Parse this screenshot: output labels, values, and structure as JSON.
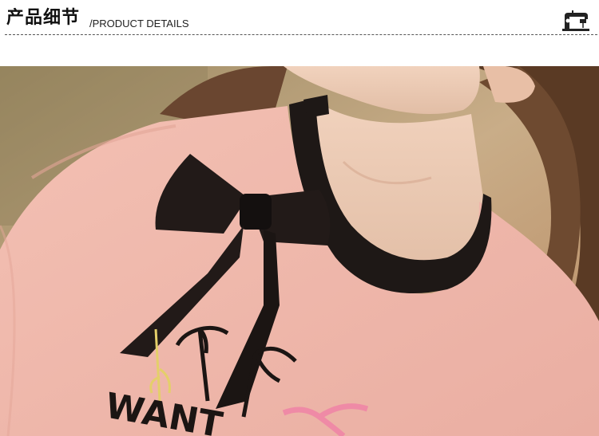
{
  "header": {
    "title_cn": "产品细节",
    "title_en": "/PRODUCT DETAILS",
    "icon": "sewing-machine-icon"
  },
  "photo": {
    "shirt_print_text": "WANT",
    "colors": {
      "background": "#b89a75",
      "skin": "#e9c9b4",
      "hair": "#5a3a24",
      "shirt": "#f0b9ad",
      "collar": "#1e1816",
      "bow": "#221a18"
    }
  }
}
